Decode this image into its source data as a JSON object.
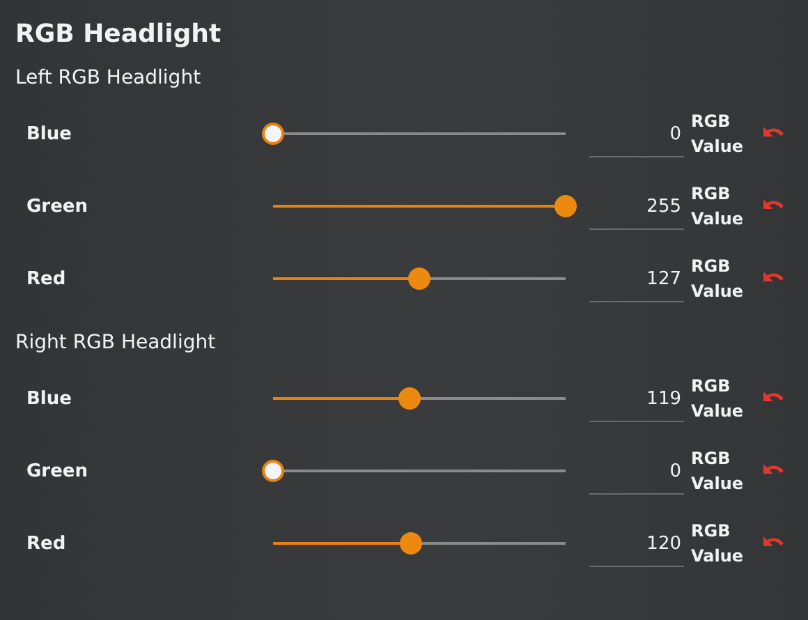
{
  "title": "RGB Headlight",
  "sections": [
    {
      "heading": "Left RGB Headlight",
      "channels": [
        {
          "name": "Blue",
          "level": 0,
          "value": "0",
          "unit": "RGB Value"
        },
        {
          "name": "Green",
          "level": 1,
          "value": "255",
          "unit": "RGB Value"
        },
        {
          "name": "Red",
          "level": 0.498,
          "value": "127",
          "unit": "RGB Value"
        }
      ]
    },
    {
      "heading": "Right RGB Headlight",
      "channels": [
        {
          "name": "Blue",
          "level": 0.467,
          "value": "119",
          "unit": "RGB Value"
        },
        {
          "name": "Green",
          "level": 0,
          "value": "0",
          "unit": "RGB Value"
        },
        {
          "name": "Red",
          "level": 0.471,
          "value": "120",
          "unit": "RGB Value"
        }
      ]
    }
  ]
}
